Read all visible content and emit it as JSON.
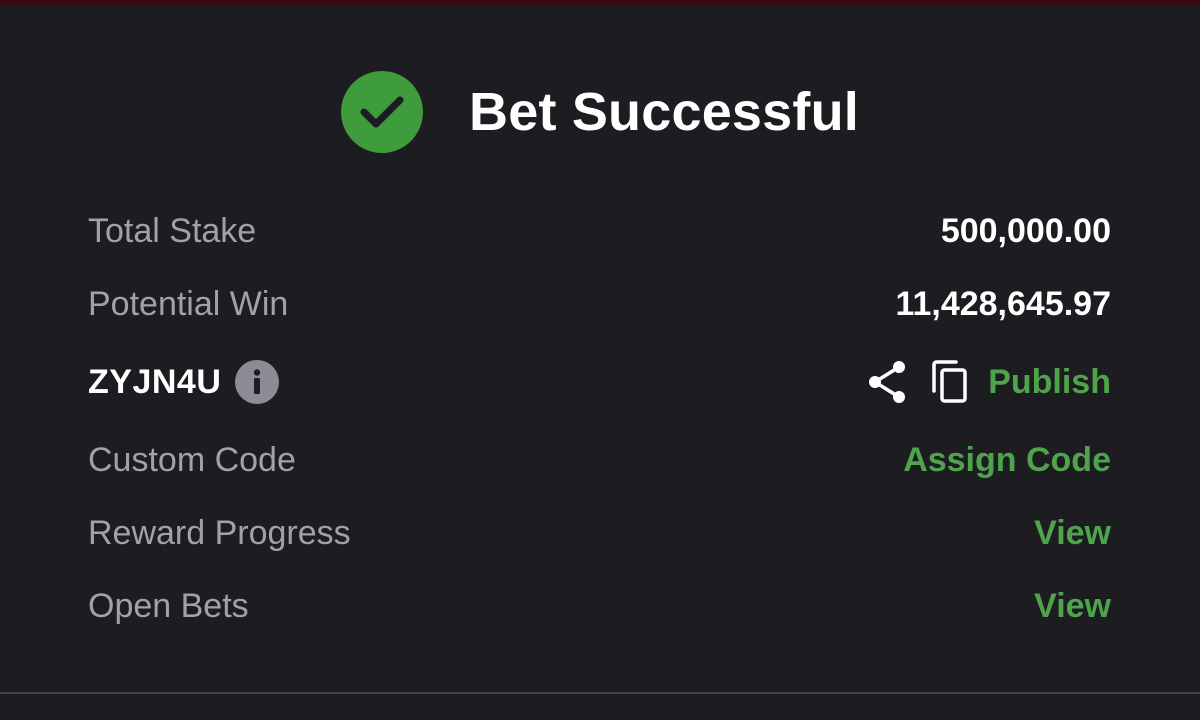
{
  "header": {
    "title": "Bet Successful"
  },
  "rows": {
    "total_stake": {
      "label": "Total Stake",
      "value": "500,000.00"
    },
    "potential_win": {
      "label": "Potential Win",
      "value": "11,428,645.97"
    },
    "booking_code": {
      "code": "ZYJN4U",
      "publish_label": "Publish"
    },
    "custom_code": {
      "label": "Custom Code",
      "action": "Assign Code"
    },
    "reward_progress": {
      "label": "Reward Progress",
      "action": "View"
    },
    "open_bets": {
      "label": "Open Bets",
      "action": "View"
    }
  },
  "colors": {
    "background": "#1c1c21",
    "accent_green": "#4ea44a",
    "success_circle": "#3f9c3c",
    "label_gray": "#a1a1ab",
    "top_bar": "#3a0c10"
  },
  "icons": [
    "check-icon",
    "info-icon",
    "share-icon",
    "copy-icon"
  ]
}
